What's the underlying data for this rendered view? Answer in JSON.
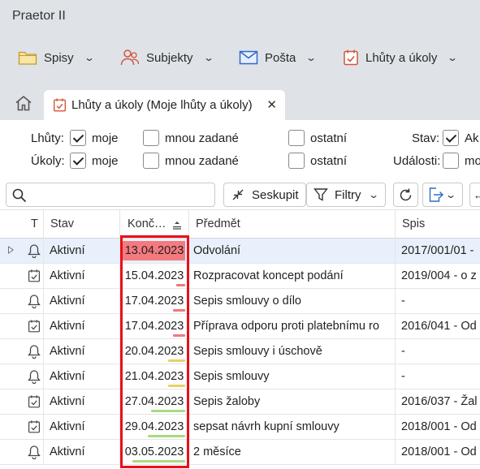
{
  "app": {
    "title": "Praetor II"
  },
  "menu": [
    {
      "label": "Spisy",
      "icon": "folder-icon"
    },
    {
      "label": "Subjekty",
      "icon": "people-icon"
    },
    {
      "label": "Pošta",
      "icon": "envelope-icon"
    },
    {
      "label": "Lhůty a úkoly",
      "icon": "calendar-check-icon"
    }
  ],
  "tab": {
    "label": "Lhůty a úkoly (Moje lhůty a úkoly)",
    "close": "✕"
  },
  "filters": {
    "lhuty_label": "Lhůty:",
    "ukoly_label": "Úkoly:",
    "moje": "moje",
    "mnou_zadane": "mnou zadané",
    "ostatni": "ostatní",
    "stav_label": "Stav:",
    "stav_value": "Ak",
    "udalosti_label": "Události:",
    "udalosti_value": "mo",
    "lhuty_moje_checked": true,
    "ukoly_moje_checked": true
  },
  "toolbar": {
    "search_placeholder": "",
    "seskupit": "Seskupit",
    "filtry": "Filtry"
  },
  "columns": {
    "t": "T",
    "stav": "Stav",
    "konec": "Konč…",
    "predmet": "Předmět",
    "spis": "Spis"
  },
  "rows": [
    {
      "type": "bell",
      "stav": "Aktivní",
      "date": "13.04.2023",
      "predmet": "Odvolání",
      "spis": "2017/001/01 - ",
      "bar_color": "",
      "bar_fill": 0,
      "highlight": "#f57a7f"
    },
    {
      "type": "check",
      "stav": "Aktivní",
      "date": "15.04.2023",
      "predmet": "Rozpracovat koncept podání",
      "spis": "2019/004 - o z",
      "bar_color": "#f0777c",
      "bar_fill": 0.15,
      "highlight": ""
    },
    {
      "type": "bell",
      "stav": "Aktivní",
      "date": "17.04.2023",
      "predmet": "Sepis smlouvy o dílo",
      "spis": " -",
      "bar_color": "#f0777c",
      "bar_fill": 0.2,
      "highlight": ""
    },
    {
      "type": "check",
      "stav": "Aktivní",
      "date": "17.04.2023",
      "predmet": "Příprava odporu proti platebnímu ro",
      "spis": "2016/041 - Od",
      "bar_color": "#f0777c",
      "bar_fill": 0.2,
      "highlight": ""
    },
    {
      "type": "bell",
      "stav": "Aktivní",
      "date": "20.04.2023",
      "predmet": "Sepis smlouvy i úschově",
      "spis": " -",
      "bar_color": "#e8d06a",
      "bar_fill": 0.27,
      "highlight": ""
    },
    {
      "type": "bell",
      "stav": "Aktivní",
      "date": "21.04.2023",
      "predmet": "Sepis smlouvy",
      "spis": " -",
      "bar_color": "#e8d06a",
      "bar_fill": 0.27,
      "highlight": ""
    },
    {
      "type": "check",
      "stav": "Aktivní",
      "date": "27.04.2023",
      "predmet": "Sepis žaloby",
      "spis": "2016/037 - Žal",
      "bar_color": "#a8db82",
      "bar_fill": 0.55,
      "highlight": ""
    },
    {
      "type": "check",
      "stav": "Aktivní",
      "date": "29.04.2023",
      "predmet": "sepsat návrh kupní smlouvy",
      "spis": "2018/001 - Od",
      "bar_color": "#a8db82",
      "bar_fill": 0.6,
      "highlight": ""
    },
    {
      "type": "bell",
      "stav": "Aktivní",
      "date": "03.05.2023",
      "predmet": "2 měsíce",
      "spis": "2018/001 - Od",
      "bar_color": "#a8db82",
      "bar_fill": 0.85,
      "highlight": ""
    }
  ]
}
